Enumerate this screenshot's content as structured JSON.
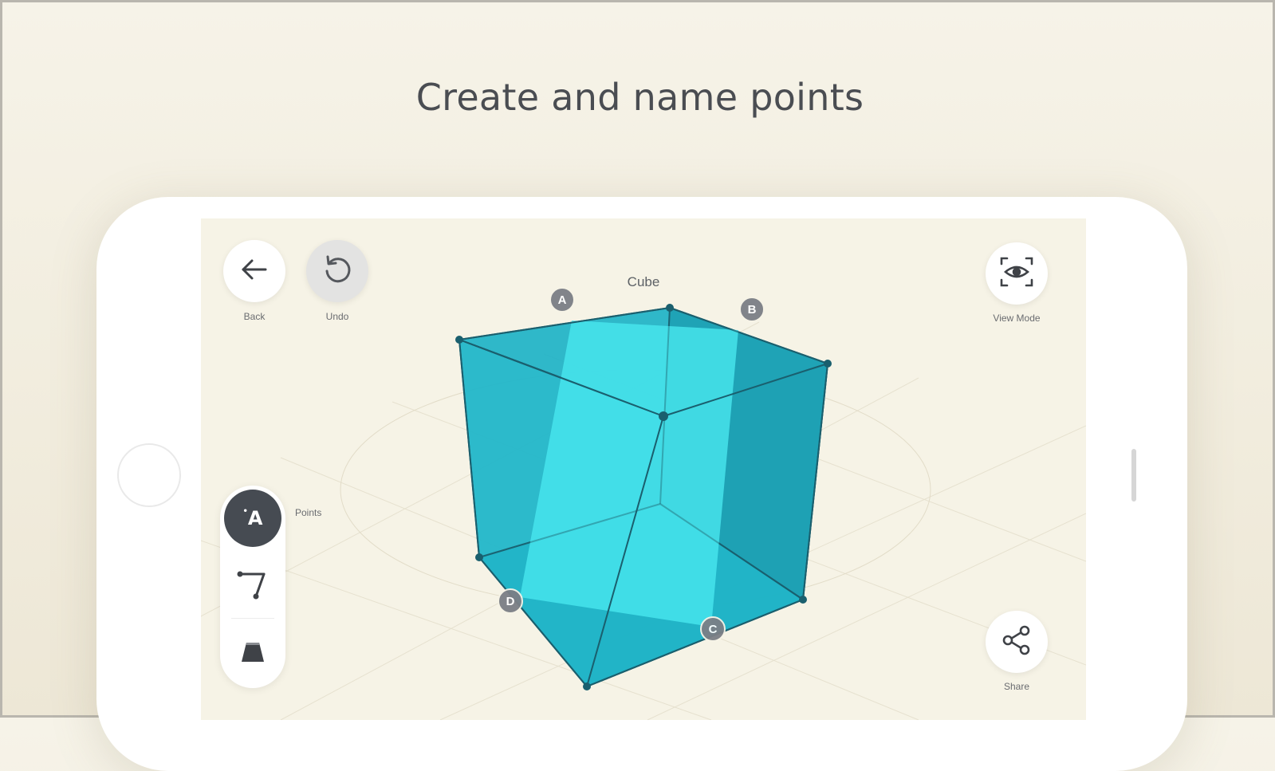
{
  "headline": "Create and name points",
  "screen": {
    "shape_title": "Cube",
    "buttons": {
      "back_label": "Back",
      "undo_label": "Undo",
      "view_mode_label": "View Mode",
      "share_label": "Share"
    },
    "tools": [
      {
        "name": "Points",
        "icon": "point-label-icon",
        "active": true,
        "glyph": "A"
      },
      {
        "name": "",
        "icon": "line-tool-icon",
        "active": false
      },
      {
        "name": "",
        "icon": "solid-shape-icon",
        "active": false
      }
    ],
    "active_tool_label": "Points",
    "point_labels": [
      "A",
      "B",
      "C",
      "D"
    ]
  },
  "colors": {
    "cube_face": "#1fb8cc",
    "cube_section": "#47e6ef",
    "edge": "#1a5f6e",
    "toolbar_active": "#464b52",
    "background": "#f6f3e6"
  }
}
